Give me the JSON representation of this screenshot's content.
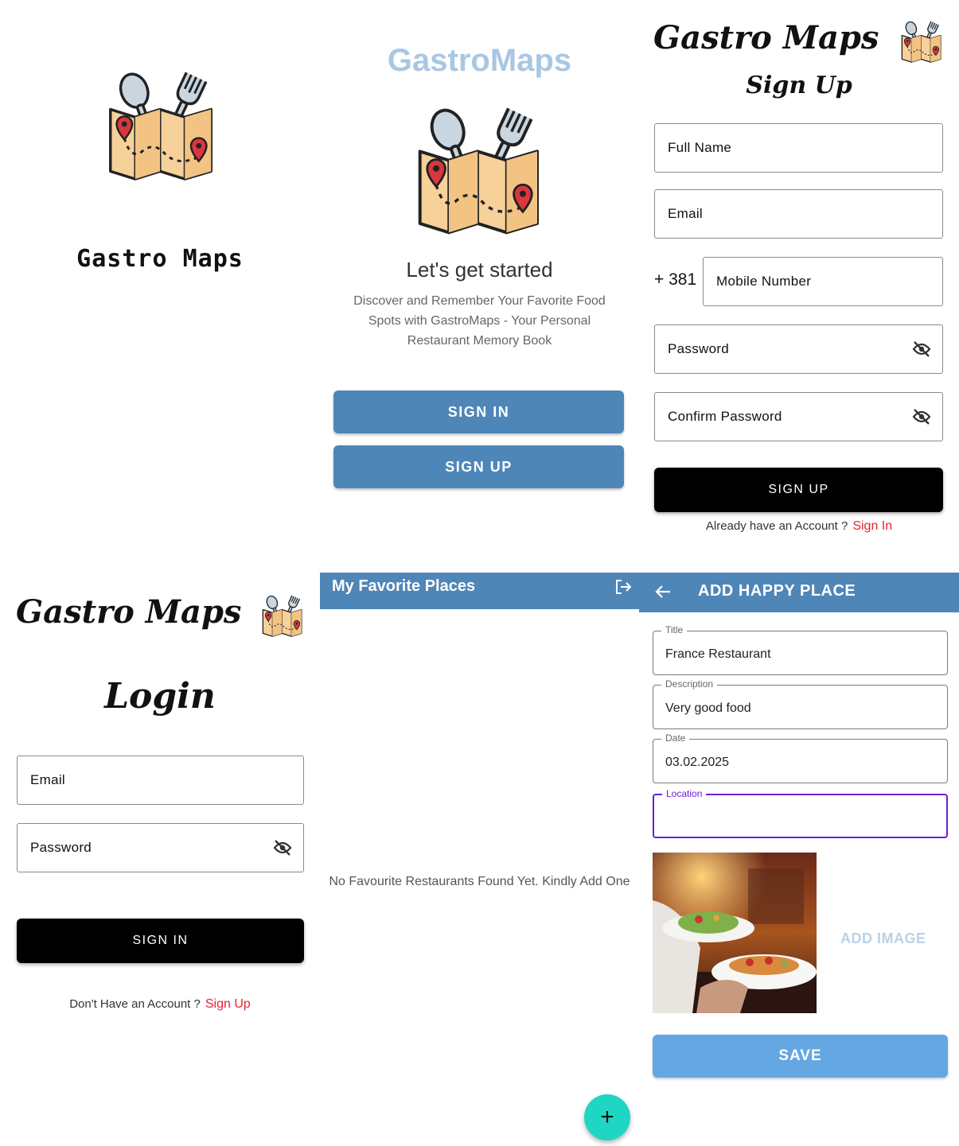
{
  "splash": {
    "brand": "Gastro Maps"
  },
  "welcome": {
    "brand": "GastroMaps",
    "headline": "Let's get started",
    "description": "Discover and Remember Your Favorite Food Spots with GastroMaps - Your Personal Restaurant Memory Book",
    "sign_in_label": "SIGN IN",
    "sign_up_label": "SIGN UP"
  },
  "signup": {
    "title": "Gastro Maps",
    "subtitle": "Sign Up",
    "full_name_placeholder": "Full Name",
    "email_placeholder": "Email",
    "country_code": "+ 381",
    "mobile_placeholder": "Mobile Number",
    "password_placeholder": "Password",
    "confirm_password_placeholder": "Confirm Password",
    "submit_label": "SIGN UP",
    "footer_text": "Already have an Account ?",
    "footer_link": "Sign In"
  },
  "login": {
    "title": "Gastro Maps",
    "subtitle": "Login",
    "email_placeholder": "Email",
    "password_placeholder": "Password",
    "submit_label": "SIGN IN",
    "footer_text": "Don't Have an Account ?",
    "footer_link": "Sign Up"
  },
  "favorites": {
    "title": "My Favorite Places",
    "empty_message": "No Favourite Restaurants Found Yet. Kindly Add One",
    "fab_label": "+"
  },
  "add_place": {
    "title": "ADD HAPPY PLACE",
    "fields": {
      "title_label": "Title",
      "title_value": "France Restaurant",
      "description_label": "Description",
      "description_value": "Very good food",
      "date_label": "Date",
      "date_value": "03.02.2025",
      "location_label": "Location",
      "location_value": ""
    },
    "add_image_label": "ADD IMAGE",
    "save_label": "SAVE"
  },
  "icons": {
    "logo": "map-with-spoon-fork-icon",
    "eye_off": "eye-off-icon",
    "logout": "logout-icon",
    "back": "arrow-left-icon",
    "add": "plus-icon"
  },
  "colors": {
    "primary_blue": "#4f86b8",
    "light_blue_brand": "#a9c7e3",
    "save_blue": "#64a7e2",
    "link_red": "#e8232d",
    "fab_teal": "#1ed6c3",
    "focus_purple": "#6a1fd6"
  }
}
